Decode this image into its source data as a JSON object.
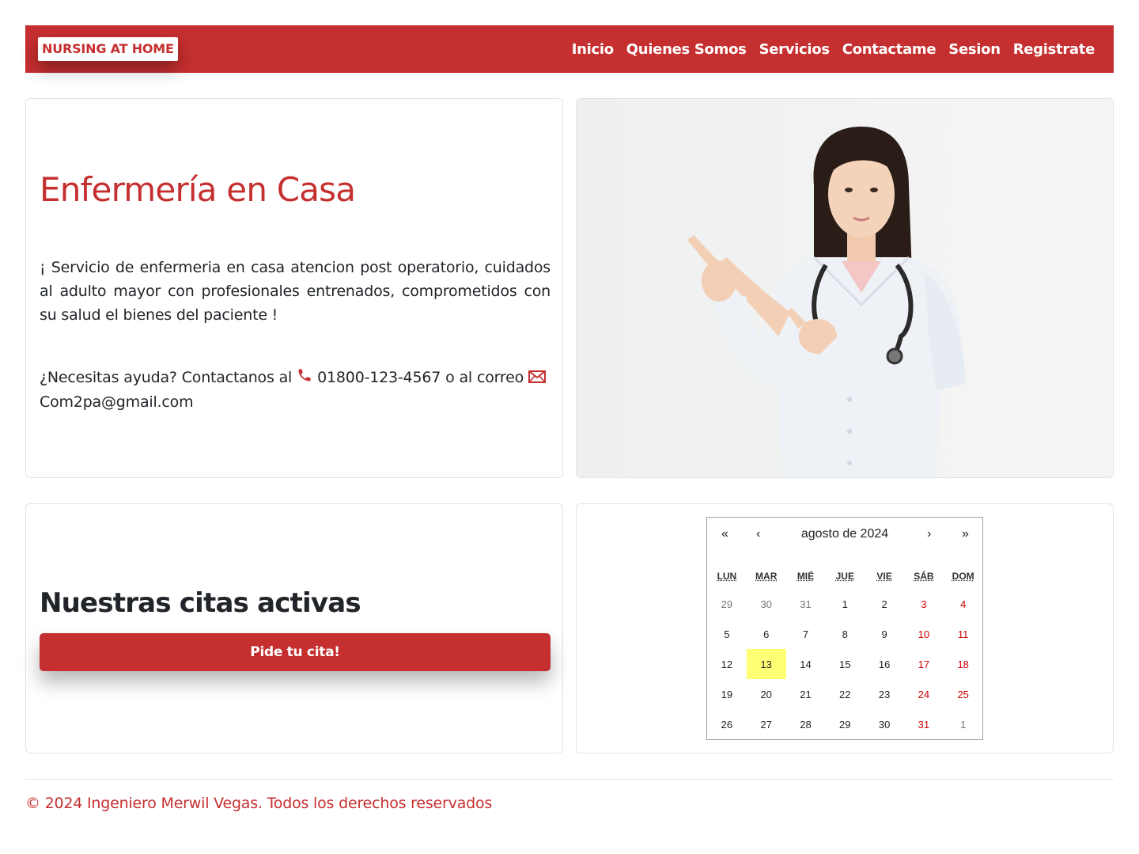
{
  "navbar": {
    "brand": "NURSING AT HOME",
    "links": [
      "Inicio",
      "Quienes Somos",
      "Servicios",
      "Contactame",
      "Sesion",
      "Registrate"
    ],
    "background": "#c62f2f"
  },
  "hero": {
    "title": "Enfermería en Casa",
    "description": "¡ Servicio de enfermeria en casa atencion post operatorio, cuidados al adulto mayor con profesionales entrenados, comprometidos con su salud el bienes del paciente !",
    "contact_prefix": "¿Necesitas ayuda? Contactanos al",
    "phone": "01800-123-4567",
    "contact_middle": "o al correo",
    "email": "Com2pa@gmail.com",
    "phone_icon": "phone-icon",
    "email_icon": "envelope-icon"
  },
  "image": {
    "alt": "nurse-photo"
  },
  "citas": {
    "title": "Nuestras citas activas",
    "button_label": "Pide tu cita!"
  },
  "calendar": {
    "month_label": "agosto de 2024",
    "nav": {
      "first": "«",
      "prev": "‹",
      "next": "›",
      "last": "»"
    },
    "weekdays": [
      "LUN",
      "MAR",
      "MIÉ",
      "JUE",
      "VIE",
      "SÁB",
      "DOM"
    ],
    "weeks": [
      [
        "29",
        "30",
        "31",
        "1",
        "2",
        "3",
        "4"
      ],
      [
        "5",
        "6",
        "7",
        "8",
        "9",
        "10",
        "11"
      ],
      [
        "12",
        "13",
        "14",
        "15",
        "16",
        "17",
        "18"
      ],
      [
        "19",
        "20",
        "21",
        "22",
        "23",
        "24",
        "25"
      ],
      [
        "26",
        "27",
        "28",
        "29",
        "30",
        "31",
        "1"
      ]
    ],
    "today": "13",
    "today_color": "#ffff76",
    "weekend_color": "#d10000"
  },
  "footer": {
    "text": "© 2024 Ingeniero Merwil Vegas. Todos los derechos reservados"
  }
}
